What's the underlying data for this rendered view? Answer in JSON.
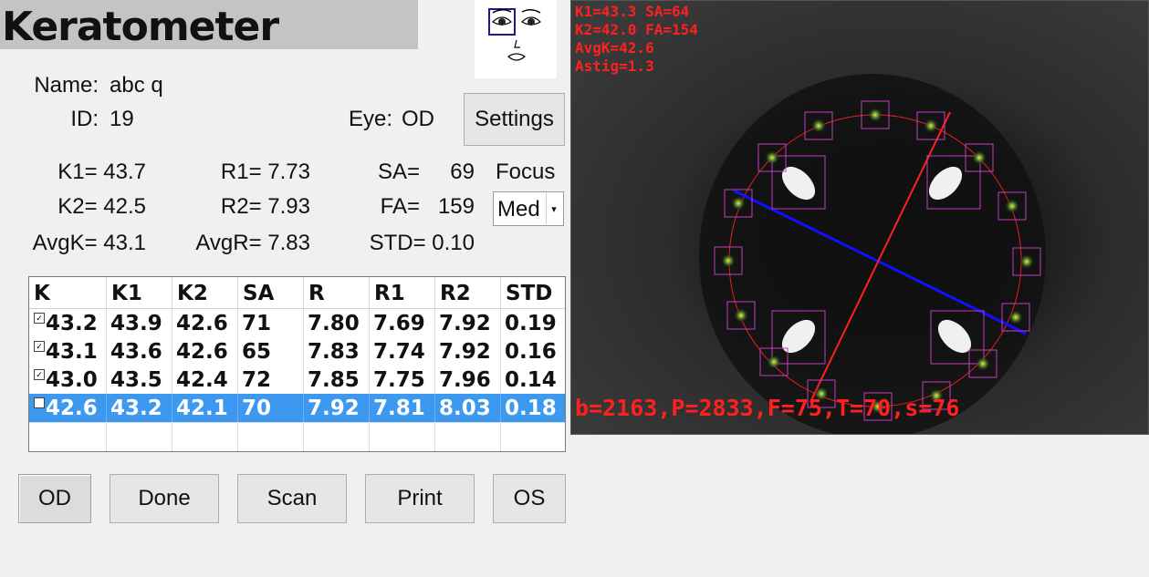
{
  "app": {
    "title": "Keratometer"
  },
  "patient": {
    "name_label": "Name:",
    "name": "abc q",
    "id_label": "ID:",
    "id": "19",
    "eye_label": "Eye:",
    "eye": "OD"
  },
  "settings_label": "Settings",
  "focus": {
    "label": "Focus",
    "value": "Med"
  },
  "measures": {
    "k1": "K1= 43.7",
    "k2": "K2= 42.5",
    "avgk": "AvgK= 43.1",
    "r1": "R1= 7.73",
    "r2": "R2= 7.93",
    "avgr": "AvgR= 7.83",
    "sa_label": "SA=",
    "sa": "69",
    "fa_label": "FA=",
    "fa": "159",
    "std": "STD= 0.10"
  },
  "table": {
    "headers": [
      "K",
      "K1",
      "K2",
      "SA",
      "R",
      "R1",
      "R2",
      "STD"
    ],
    "rows": [
      {
        "checked": true,
        "cells": [
          "43.2",
          "43.9",
          "42.6",
          "71",
          "7.80",
          "7.69",
          "7.92",
          "0.19"
        ]
      },
      {
        "checked": true,
        "cells": [
          "43.1",
          "43.6",
          "42.6",
          "65",
          "7.83",
          "7.74",
          "7.92",
          "0.16"
        ]
      },
      {
        "checked": true,
        "cells": [
          "43.0",
          "43.5",
          "42.4",
          "72",
          "7.85",
          "7.75",
          "7.96",
          "0.14"
        ]
      },
      {
        "checked": false,
        "selected": true,
        "cells": [
          "42.6",
          "43.2",
          "42.1",
          "70",
          "7.92",
          "7.81",
          "8.03",
          "0.18"
        ]
      }
    ]
  },
  "buttons": {
    "od": "OD",
    "done": "Done",
    "scan": "Scan",
    "print": "Print",
    "os": "OS"
  },
  "camera": {
    "line1": "K1=43.3 SA=64",
    "line2": "K2=42.0 FA=154",
    "line3": "AvgK=42.6",
    "line4": "Astig=1.3",
    "status": "b=2163,P=2833,F=75,T=70,s=76"
  },
  "colors": {
    "selected_row": "#3d98f0",
    "overlay_red": "#ff2020",
    "axis_blue": "#1010ff",
    "marker_box": "#c040c0"
  }
}
